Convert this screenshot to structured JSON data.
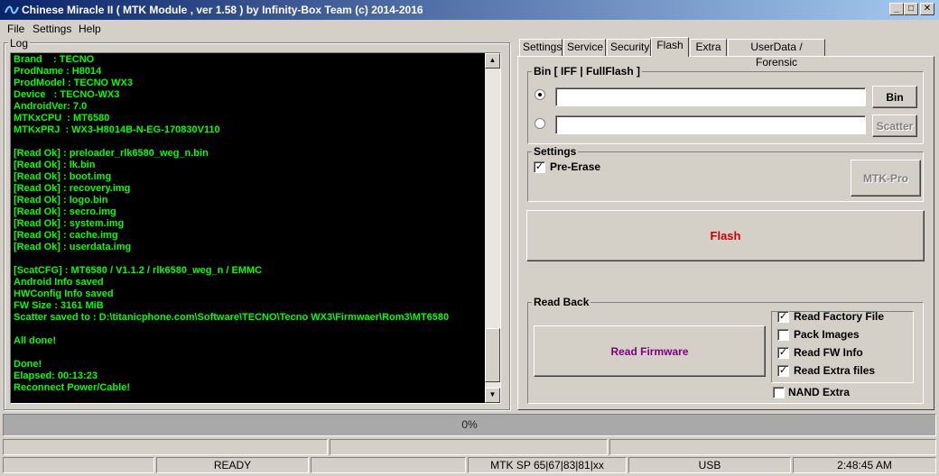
{
  "window": {
    "title": "Chinese Miracle II ( MTK Module , ver 1.58 ) by Infinity-Box Team (c) 2014-2016",
    "min": "_",
    "max": "□",
    "close": "✕"
  },
  "menu": [
    "File",
    "Settings",
    "Help"
  ],
  "log": {
    "legend": "Log",
    "lines": [
      "Brand    : TECNO",
      "ProdName : H8014",
      "ProdModel : TECNO WX3",
      "Device   : TECNO-WX3",
      "AndroidVer: 7.0",
      "MTKxCPU  : MT6580",
      "MTKxPRJ  : WX3-H8014B-N-EG-170830V110",
      "",
      "[Read Ok] : preloader_rlk6580_weg_n.bin",
      "[Read Ok] : lk.bin",
      "[Read Ok] : boot.img",
      "[Read Ok] : recovery.img",
      "[Read Ok] : logo.bin",
      "[Read Ok] : secro.img",
      "[Read Ok] : system.img",
      "[Read Ok] : cache.img",
      "[Read Ok] : userdata.img",
      "",
      "[ScatCFG] : MT6580 / V1.1.2 / rlk6580_weg_n / EMMC",
      "Android Info saved",
      "HWConfig Info saved",
      "FW Size : 3161 MiB",
      "Scatter saved to : D:\\titanicphone.com\\Software\\TECNO\\Tecno WX3\\Firmwaer\\Rom3\\MT6580",
      "",
      "All done!",
      "",
      "Done!",
      "Elapsed: 00:13:23",
      "Reconnect Power/Cable!"
    ],
    "scroll_up": "▲",
    "scroll_down": "▼"
  },
  "tabs": [
    "Settings",
    "Service",
    "Security",
    "Flash",
    "Extra",
    "UserData / Forensic"
  ],
  "flash": {
    "bin_group_title": "Bin  [ IFF | FullFlash ]",
    "bin_path_value": "",
    "scatter_path_value": "",
    "bin_button": "Bin",
    "scatter_button": "Scatter",
    "settings_group_title": "Settings",
    "pre_erase_label": "Pre-Erase",
    "pre_erase_checked": true,
    "mtk_pro_button": "MTK-Pro",
    "flash_button": "Flash",
    "readback_group_title": "Read Back",
    "read_firmware_button": "Read Firmware",
    "options": [
      {
        "label": "Read Factory File",
        "checked": true
      },
      {
        "label": "Pack Images",
        "checked": false
      },
      {
        "label": "Read FW Info",
        "checked": true
      },
      {
        "label": "Read Extra files",
        "checked": true
      }
    ],
    "nand_extra_label": "NAND Extra",
    "nand_extra_checked": false
  },
  "colors": {
    "log_text": "#00ff00",
    "flash_button_text": "#cc0000",
    "read_firmware_text": "#800080"
  },
  "progress": {
    "text": "0%"
  },
  "status": {
    "ready": "READY",
    "protocol": "MTK SP 65|67|83|81|xx",
    "port": "USB",
    "time": "2:48:45 AM"
  }
}
